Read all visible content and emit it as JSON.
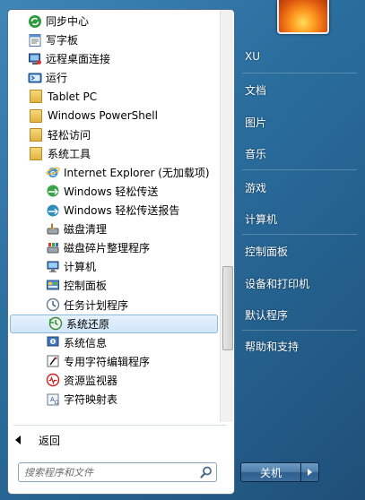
{
  "programs": {
    "items": [
      {
        "label": "同步中心",
        "icon": "sync-center-icon",
        "level": 0
      },
      {
        "label": "写字板",
        "icon": "wordpad-icon",
        "level": 0
      },
      {
        "label": "远程桌面连接",
        "icon": "remote-desktop-icon",
        "level": 0
      },
      {
        "label": "运行",
        "icon": "run-icon",
        "level": 0
      },
      {
        "label": "Tablet PC",
        "icon": "folder-icon",
        "level": 0
      },
      {
        "label": "Windows PowerShell",
        "icon": "folder-icon",
        "level": 0
      },
      {
        "label": "轻松访问",
        "icon": "folder-icon",
        "level": 0
      },
      {
        "label": "系统工具",
        "icon": "folder-icon",
        "level": 0
      },
      {
        "label": "Internet Explorer (无加载项)",
        "icon": "internet-explorer-icon",
        "level": 1
      },
      {
        "label": "Windows 轻松传送",
        "icon": "easy-transfer-icon",
        "level": 1
      },
      {
        "label": "Windows 轻松传送报告",
        "icon": "easy-transfer-report-icon",
        "level": 1
      },
      {
        "label": "磁盘清理",
        "icon": "disk-cleanup-icon",
        "level": 1
      },
      {
        "label": "磁盘碎片整理程序",
        "icon": "defragmenter-icon",
        "level": 1
      },
      {
        "label": "计算机",
        "icon": "computer-icon",
        "level": 1
      },
      {
        "label": "控制面板",
        "icon": "control-panel-icon",
        "level": 1
      },
      {
        "label": "任务计划程序",
        "icon": "task-scheduler-icon",
        "level": 1
      },
      {
        "label": "系统还原",
        "icon": "system-restore-icon",
        "level": 1,
        "selected": true
      },
      {
        "label": "系统信息",
        "icon": "system-info-icon",
        "level": 1
      },
      {
        "label": "专用字符编辑程序",
        "icon": "private-char-editor-icon",
        "level": 1
      },
      {
        "label": "资源监视器",
        "icon": "resource-monitor-icon",
        "level": 1
      },
      {
        "label": "字符映射表",
        "icon": "character-map-icon",
        "level": 1
      }
    ]
  },
  "back_label": "返回",
  "search": {
    "placeholder": "搜索程序和文件"
  },
  "right_menu": {
    "items": [
      "XU",
      "文档",
      "图片",
      "音乐",
      "游戏",
      "计算机",
      "控制面板",
      "设备和打印机",
      "默认程序",
      "帮助和支持"
    ]
  },
  "shutdown_label": "关机",
  "colors": {
    "selection": "#cfe6fa",
    "accent": "#2a6e9e"
  }
}
